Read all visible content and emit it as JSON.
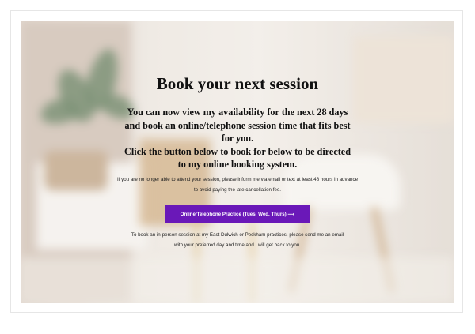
{
  "hero": {
    "title": "Book your next session",
    "lead_1": "You can now view my availability for the next 28 days and book an online/telephone session time that fits best for you.",
    "lead_2": "Click the button below to book for below to be directed to my online booking system.",
    "note": "If you are no longer able to attend your session, please inform me via email or text at least 48 hours in advance to avoid paying the late cancellation fee.",
    "cta_label": "Online/Telephone Practice (Tues, Wed, Thurs) ⟶",
    "footer_1": "To book an in-person session at my East Dulwich or Peckham practices, please send me an email",
    "footer_2": "with your preferred day and time and I will get back to you."
  },
  "colors": {
    "button": "#6a18b8",
    "text": "#111111"
  }
}
